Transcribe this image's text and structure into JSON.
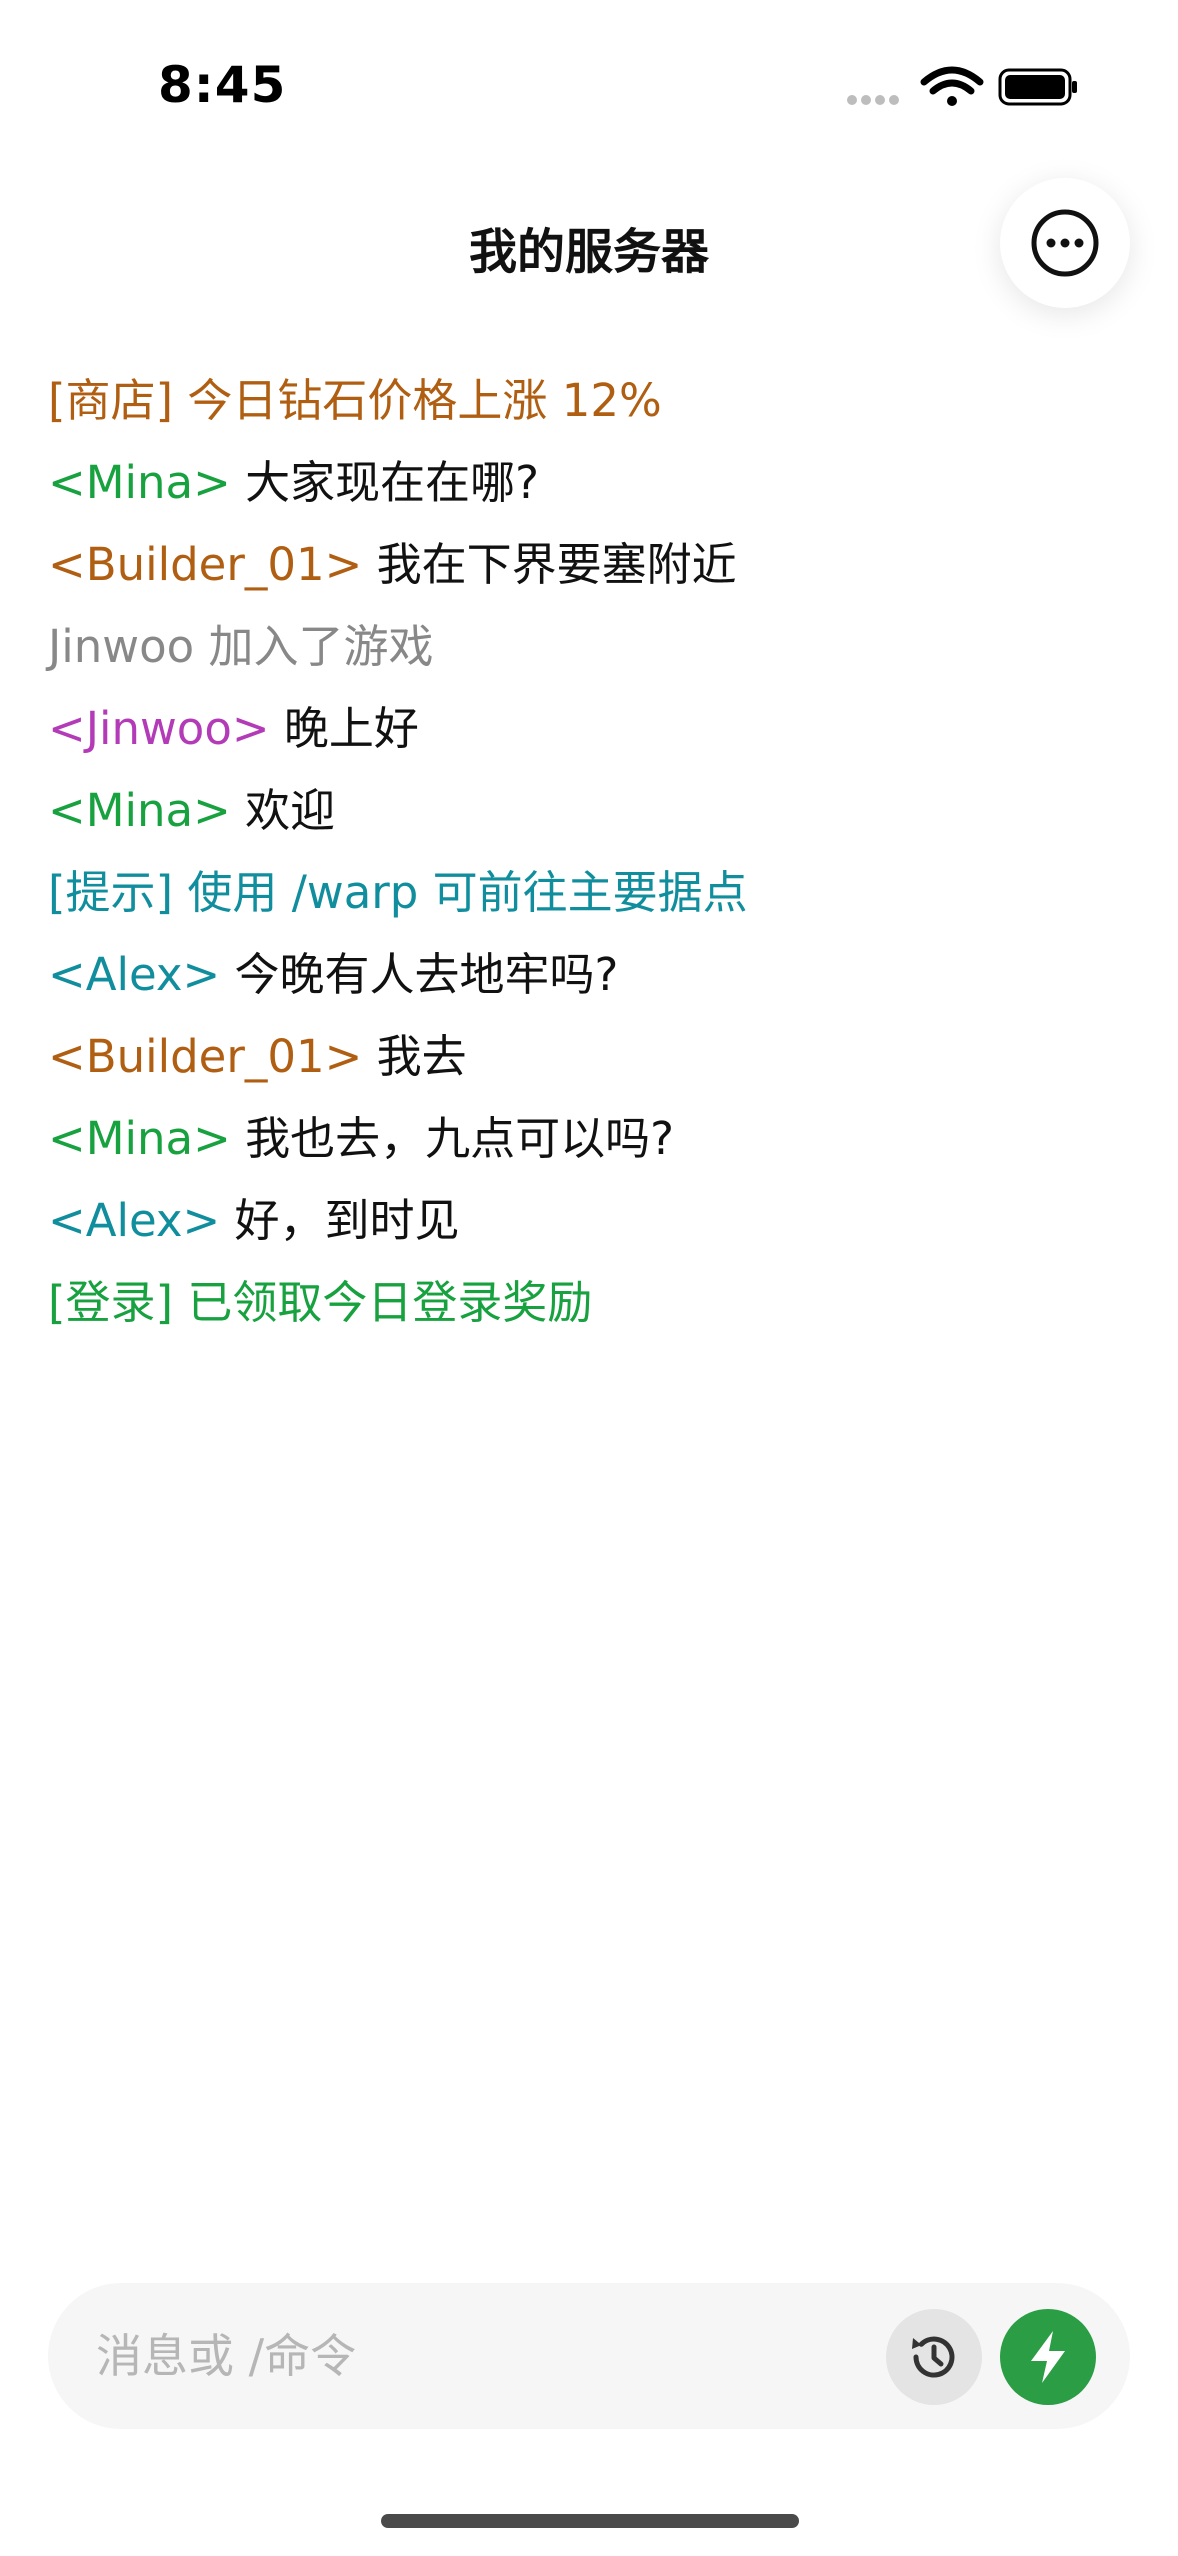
{
  "status_bar": {
    "time": "8:45",
    "icons": [
      "signal-dots-icon",
      "wifi-icon",
      "battery-icon"
    ]
  },
  "header": {
    "title": "我的服务器",
    "more_icon": "ellipsis-circle-icon"
  },
  "colors": {
    "orange": "#b05f12",
    "green": "#17a13f",
    "teal": "#118e9e",
    "magenta": "#b33bb7",
    "gray": "#888888",
    "send_button": "#2a9d45"
  },
  "chat": {
    "lines": [
      {
        "prefix": "[商店]",
        "text": " 今日钻石价格上涨 12%"
      },
      {
        "prefix": "<Mina>",
        "text": " 大家现在在哪?"
      },
      {
        "prefix": "<Builder_01>",
        "text": " 我在下界要塞附近"
      },
      {
        "prefix": "",
        "text": "Jinwoo 加入了游戏"
      },
      {
        "prefix": "<Jinwoo>",
        "text": " 晚上好"
      },
      {
        "prefix": "<Mina>",
        "text": " 欢迎"
      },
      {
        "prefix": "[提示]",
        "text": " 使用 /warp 可前往主要据点"
      },
      {
        "prefix": "<Alex>",
        "text": " 今晚有人去地牢吗?"
      },
      {
        "prefix": "<Builder_01>",
        "text": " 我去"
      },
      {
        "prefix": "<Mina>",
        "text": " 我也去，九点可以吗?"
      },
      {
        "prefix": "<Alex>",
        "text": " 好，到时见"
      },
      {
        "prefix": "[登录]",
        "text": " 已领取今日登录奖励"
      }
    ]
  },
  "input": {
    "value": "",
    "placeholder": "消息或 /命令",
    "history_icon": "history-clock-icon",
    "send_icon": "lightning-bolt-icon"
  }
}
